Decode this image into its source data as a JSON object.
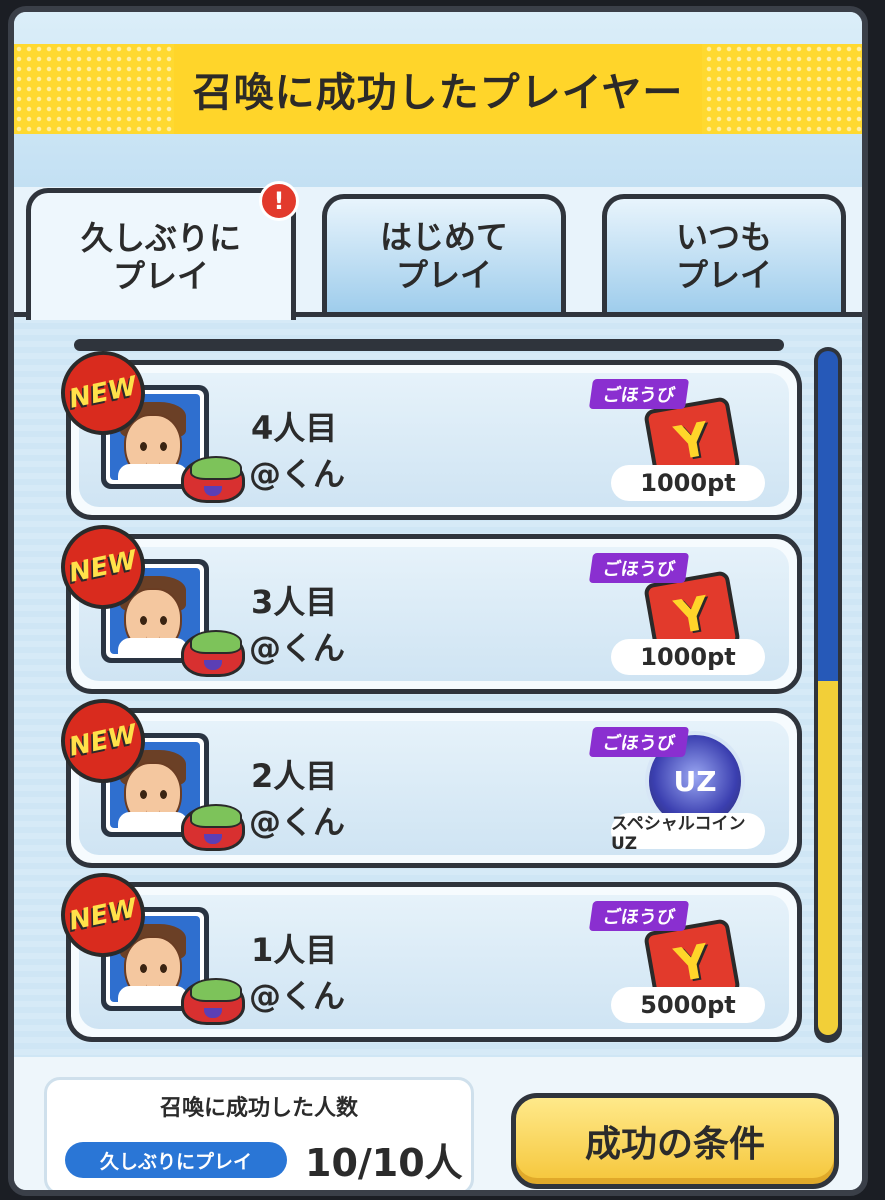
{
  "title": "召喚に成功したプレイヤー",
  "tabs": [
    {
      "label": "久しぶりに\nプレイ",
      "active": true,
      "badge": "!"
    },
    {
      "label": "はじめて\nプレイ",
      "active": false
    },
    {
      "label": "いつも\nプレイ",
      "active": false
    }
  ],
  "players": [
    {
      "new_label": "NEW",
      "rank": "4人目",
      "name": "@くん",
      "reward_tag": "ごほうび",
      "reward_icon": "Y",
      "reward": "1000pt"
    },
    {
      "new_label": "NEW",
      "rank": "3人目",
      "name": "@くん",
      "reward_tag": "ごほうび",
      "reward_icon": "Y",
      "reward": "1000pt"
    },
    {
      "new_label": "NEW",
      "rank": "2人目",
      "name": "@くん",
      "reward_tag": "ごほうび",
      "reward_icon": "UZ",
      "reward": "スペシャルコインUZ"
    },
    {
      "new_label": "NEW",
      "rank": "1人目",
      "name": "@くん",
      "reward_tag": "ごほうび",
      "reward_icon": "Y",
      "reward": "5000pt"
    }
  ],
  "summary": {
    "title": "召喚に成功した人数",
    "category": "久しぶりにプレイ",
    "count": "10/10人"
  },
  "condition_button": "成功の条件",
  "colors": {
    "banner": "#ffd930",
    "new_badge": "#d92b1e",
    "reward_tag": "#8a2fd0",
    "scroll_thumb": "#f2cf38"
  }
}
